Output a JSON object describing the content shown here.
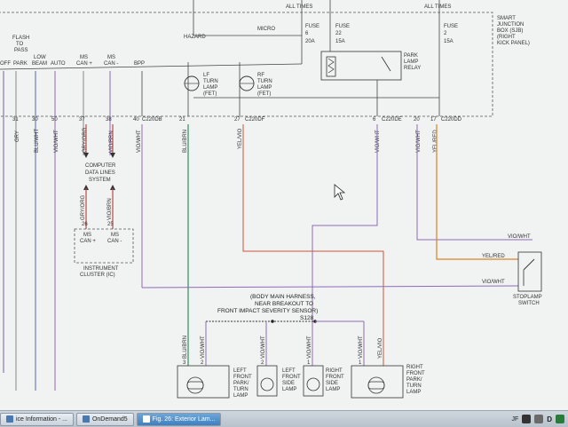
{
  "top": {
    "all_times_left": "ALL TIMES",
    "all_times_right": "ALL TIMES",
    "hazard": "HAZARD",
    "micro": "MICRO",
    "fuse1": [
      "FUSE",
      "6",
      "20A"
    ],
    "fuse2": [
      "FUSE",
      "22",
      "15A"
    ],
    "fuse3": [
      "FUSE",
      "2",
      "15A"
    ],
    "sjb": [
      "SMART",
      "JUNCTION",
      "BOX (SJB)",
      "(RIGHT",
      "KICK PANEL)"
    ],
    "relay": [
      "PARK",
      "LAMP",
      "RELAY"
    ],
    "lf_lamp": [
      "LF",
      "TURN",
      "LAMP",
      "(FET)"
    ],
    "rf_lamp": [
      "RF",
      "TURN",
      "LAMP",
      "(FET)"
    ]
  },
  "switch_labels": {
    "flash": [
      "FLASH",
      "TO",
      "PASS"
    ],
    "off": "OFF",
    "park": "PARK",
    "low_beam": [
      "LOW",
      "BEAM"
    ],
    "auto": "AUTO",
    "ms_can_plus": [
      "MS",
      "CAN +"
    ],
    "ms_can_minus": [
      "MS",
      "CAN -"
    ],
    "bpp": "BPP"
  },
  "pins": {
    "p31": "31",
    "p30": "30",
    "p50": "50",
    "p37": "37",
    "p38": "38",
    "p40": "40",
    "c220db": "C220DB",
    "p21": "21",
    "p27": "27",
    "c220df": "C220DF",
    "p6": "6",
    "c220de": "C220DE",
    "p20": "20",
    "p17": "17",
    "c220dd": "C220DD",
    "p26": "26",
    "p25": "25",
    "p3": "3",
    "p2": "2",
    "p2b": "2",
    "p1": "1",
    "p1b": "1"
  },
  "wires": {
    "gry": "GRY",
    "blu_wht": "BLU/WHT",
    "vio_wht": "VIO/WHT",
    "gry_org": "GRY/ORG",
    "vio_brn": "VIO/BRN",
    "vio_wht2": "VIO/WHT",
    "blu_brn": "BLU/BRN",
    "yel_vio": "YEL/VIO",
    "vio_wht3": "VIO/WHT",
    "vio_wht4": "VIO/WHT",
    "yel_red": "YEL/RED",
    "vio_wht_h": "VIO/WHT",
    "yel_red_h": "YEL/RED",
    "vio_wht_h2": "VIO/WHT",
    "gry_org2": "GRY/ORG",
    "vio_brn2": "VIO/BRN",
    "blu_brn2": "BLU/BRN",
    "vio_wht5": "VIO/WHT",
    "vio_wht6": "VIO/WHT",
    "vio_wht7": "VIO/WHT",
    "vio_wht8": "VIO/WHT",
    "yel_vio2": "YEL/VIO"
  },
  "computer": [
    "COMPUTER",
    "DATA LINES",
    "SYSTEM"
  ],
  "ic": {
    "ms_can_plus": [
      "MS",
      "CAN +"
    ],
    "ms_can_minus": [
      "MS",
      "CAN -"
    ],
    "title": [
      "INSTRUMENT",
      "CLUSTER (IC)"
    ]
  },
  "harness": [
    "(BODY MAIN HARNESS,",
    "NEAR BREAKOUT TO",
    "FRONT IMPACT SEVERITY SENSOR)",
    "S128"
  ],
  "stoplamp": [
    "STOPLAMP",
    "SWITCH"
  ],
  "lamps": {
    "lf_park": [
      "LEFT",
      "FRONT",
      "PARK/",
      "TURN",
      "LAMP"
    ],
    "lf_side": [
      "LEFT",
      "FRONT",
      "SIDE",
      "LAMP"
    ],
    "rf_side": [
      "RIGHT",
      "FRONT",
      "SIDE",
      "LAMP"
    ],
    "rf_park": [
      "RIGHT",
      "FRONT",
      "PARK/",
      "TURN",
      "LAMP"
    ]
  },
  "taskbar": {
    "item1": "ice Information - ...",
    "item2": "OnDemand5",
    "item3": "Fig. 26: Exterior Lam...",
    "tray_letter": "D",
    "tray_letter2": "JF"
  }
}
